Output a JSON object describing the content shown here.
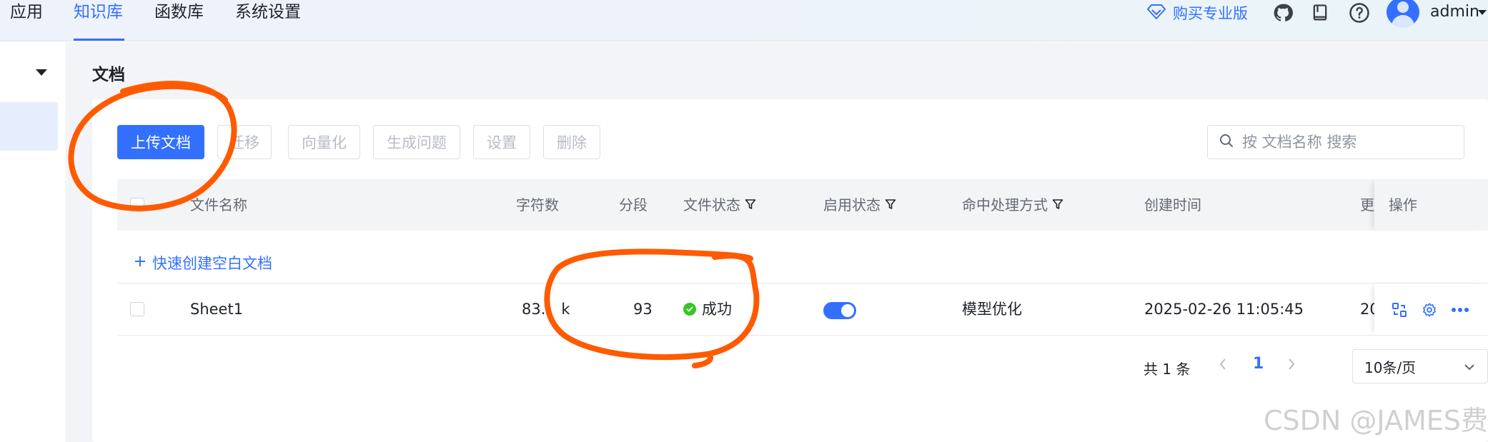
{
  "nav": {
    "items": [
      "应用",
      "知识库",
      "函数库",
      "系统设置"
    ],
    "upgrade_label": "购买专业版",
    "username": "admin"
  },
  "page": {
    "title": "文档"
  },
  "toolbar": {
    "upload": "上传文档",
    "migrate": "迁移",
    "vectorize": "向量化",
    "generate_questions": "生成问题",
    "settings": "设置",
    "delete": "删除",
    "search_placeholder": "按 文档名称 搜索"
  },
  "table": {
    "headers": {
      "name": "文件名称",
      "chars": "字符数",
      "segments": "分段",
      "file_status": "文件状态",
      "enable_status": "启用状态",
      "hit_handling": "命中处理方式",
      "created": "创建时间",
      "updated": "更",
      "actions": "操作"
    },
    "quick_create": "快速创建空白文档",
    "rows": [
      {
        "name": "Sheet1",
        "chars": "83.",
        "chars_suffix": "k",
        "segments": "93",
        "file_status": "成功",
        "enabled": true,
        "hit_handling": "模型优化",
        "created": "2025-02-26 11:05:45",
        "updated": "20"
      }
    ]
  },
  "pagination": {
    "total": "共 1 条",
    "current": "1",
    "page_size": "10条/页"
  },
  "watermark": "CSDN @JAMES费",
  "colors": {
    "accent": "#3370ff",
    "annotation": "#ff5a00",
    "success": "#34c724"
  }
}
